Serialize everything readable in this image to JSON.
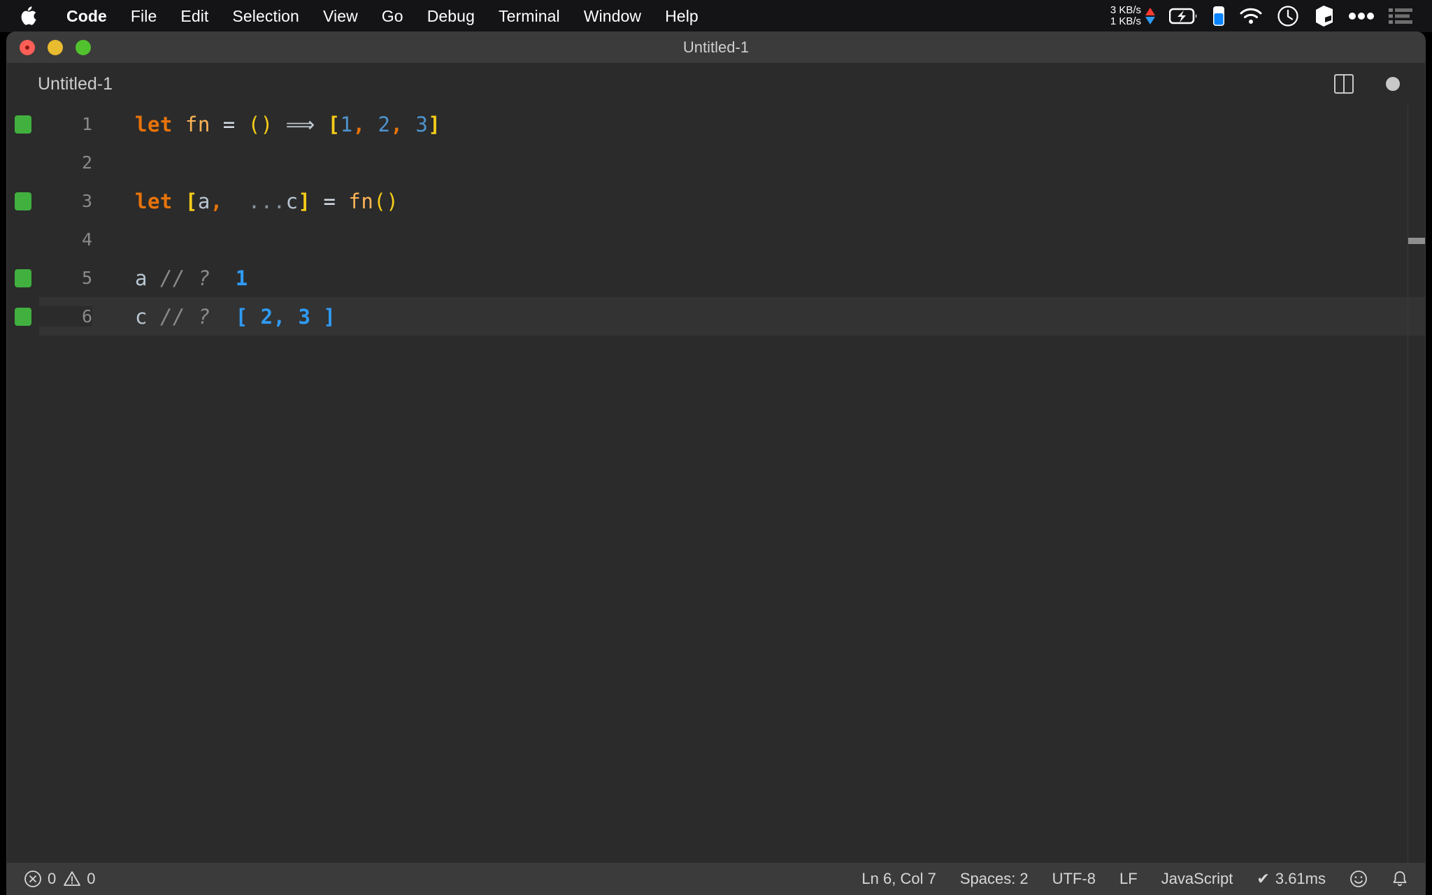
{
  "menubar": {
    "apple_icon": "apple-logo-icon",
    "items": [
      {
        "label": "Code",
        "bold": true
      },
      {
        "label": "File",
        "bold": false
      },
      {
        "label": "Edit",
        "bold": false
      },
      {
        "label": "Selection",
        "bold": false
      },
      {
        "label": "View",
        "bold": false
      },
      {
        "label": "Go",
        "bold": false
      },
      {
        "label": "Debug",
        "bold": false
      },
      {
        "label": "Terminal",
        "bold": false
      },
      {
        "label": "Window",
        "bold": false
      },
      {
        "label": "Help",
        "bold": false
      }
    ],
    "network": {
      "upload": "3 KB/s",
      "download": "1 KB/s",
      "up_arrow_color": "#ff3b30",
      "down_arrow_color": "#2f9bf5"
    },
    "status_icons": [
      "battery-charging-icon",
      "phone-battery-icon",
      "wifi-icon",
      "clock-icon",
      "cube-icon",
      "ellipsis-icon",
      "control-center-icon"
    ]
  },
  "window": {
    "title": "Untitled-1",
    "traffic_lights": [
      "close",
      "minimize",
      "zoom"
    ]
  },
  "tabbar": {
    "active_tab": "Untitled-1",
    "actions": [
      "split-editor-icon",
      "unsaved-dot-icon"
    ]
  },
  "editor": {
    "language": "JavaScript",
    "lines": [
      {
        "number": "1",
        "git_marker": true,
        "current": false,
        "tokens": [
          {
            "text": "let",
            "cls": "t-kw"
          },
          {
            "text": " ",
            "cls": "t-plain"
          },
          {
            "text": "fn",
            "cls": "t-fn"
          },
          {
            "text": " ",
            "cls": "t-plain"
          },
          {
            "text": "=",
            "cls": "t-op"
          },
          {
            "text": " ",
            "cls": "t-plain"
          },
          {
            "text": "()",
            "cls": "t-paren"
          },
          {
            "text": " ",
            "cls": "t-plain"
          },
          {
            "text": "⟹",
            "cls": "t-arrow"
          },
          {
            "text": " ",
            "cls": "t-plain"
          },
          {
            "text": "[",
            "cls": "t-bracket"
          },
          {
            "text": "1",
            "cls": "t-num"
          },
          {
            "text": ",",
            "cls": "t-comma"
          },
          {
            "text": " ",
            "cls": "t-plain"
          },
          {
            "text": "2",
            "cls": "t-num"
          },
          {
            "text": ",",
            "cls": "t-comma"
          },
          {
            "text": " ",
            "cls": "t-plain"
          },
          {
            "text": "3",
            "cls": "t-num"
          },
          {
            "text": "]",
            "cls": "t-bracket"
          }
        ]
      },
      {
        "number": "2",
        "git_marker": false,
        "current": false,
        "tokens": []
      },
      {
        "number": "3",
        "git_marker": true,
        "current": false,
        "tokens": [
          {
            "text": "let",
            "cls": "t-kw"
          },
          {
            "text": " ",
            "cls": "t-plain"
          },
          {
            "text": "[",
            "cls": "t-bracket"
          },
          {
            "text": "a",
            "cls": "t-var"
          },
          {
            "text": ",",
            "cls": "t-comma"
          },
          {
            "text": "  ",
            "cls": "t-plain"
          },
          {
            "text": "...",
            "cls": "t-dots"
          },
          {
            "text": "c",
            "cls": "t-var"
          },
          {
            "text": "]",
            "cls": "t-bracket"
          },
          {
            "text": " ",
            "cls": "t-plain"
          },
          {
            "text": "=",
            "cls": "t-op"
          },
          {
            "text": " ",
            "cls": "t-plain"
          },
          {
            "text": "fn",
            "cls": "t-fn"
          },
          {
            "text": "()",
            "cls": "t-paren"
          }
        ]
      },
      {
        "number": "4",
        "git_marker": false,
        "current": false,
        "tokens": []
      },
      {
        "number": "5",
        "git_marker": true,
        "current": false,
        "tokens": [
          {
            "text": "a",
            "cls": "t-var"
          },
          {
            "text": " ",
            "cls": "t-plain"
          },
          {
            "text": "// ?",
            "cls": "t-comment"
          },
          {
            "text": "  ",
            "cls": "t-plain"
          },
          {
            "text": "1",
            "cls": "t-result"
          }
        ]
      },
      {
        "number": "6",
        "git_marker": true,
        "current": true,
        "tokens": [
          {
            "text": "c",
            "cls": "t-var"
          },
          {
            "text": " ",
            "cls": "t-plain"
          },
          {
            "text": "// ?",
            "cls": "t-comment"
          },
          {
            "text": "  ",
            "cls": "t-plain"
          },
          {
            "text": "[ 2, 3 ]",
            "cls": "t-result"
          }
        ]
      }
    ]
  },
  "statusbar": {
    "errors": "0",
    "warnings": "0",
    "cursor": "Ln 6, Col 7",
    "indentation": "Spaces: 2",
    "encoding": "UTF-8",
    "eol": "LF",
    "language": "JavaScript",
    "timing": "3.61ms",
    "timing_check": "✔",
    "feedback_icon": "smiley-icon",
    "notifications_icon": "bell-icon"
  },
  "colors": {
    "window_bg": "#2b2b2b",
    "titlebar_bg": "#3b3b3b",
    "git_added": "#41b03f",
    "keyword": "#e8730a",
    "result": "#2f9bf5"
  }
}
